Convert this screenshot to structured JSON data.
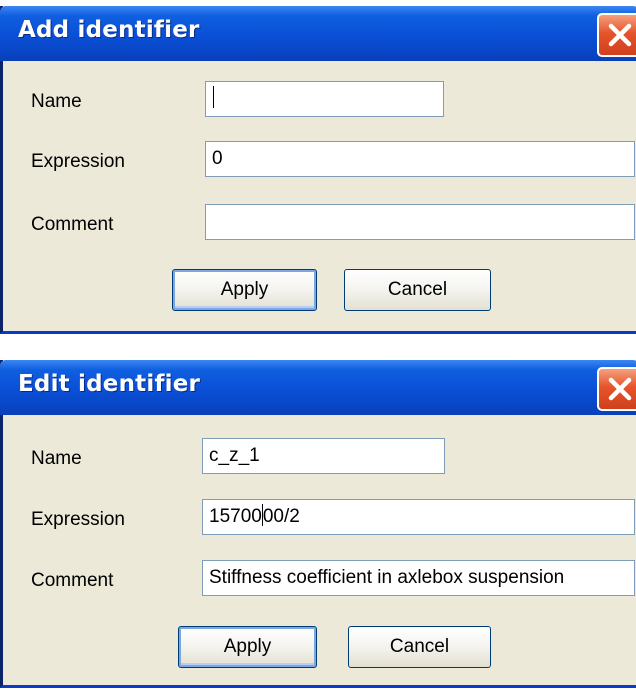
{
  "add_dialog": {
    "title": "Add identifier",
    "name_label": "Name",
    "name_value": "",
    "expression_label": "Expression",
    "expression_value": "0",
    "comment_label": "Comment",
    "comment_value": "",
    "apply_label": "Apply",
    "cancel_label": "Cancel",
    "close_icon": "close-icon"
  },
  "edit_dialog": {
    "title": "Edit identifier",
    "name_label": "Name",
    "name_value": "c_z_1",
    "expression_label": "Expression",
    "expression_before_caret": "15700",
    "expression_after_caret": "00/2",
    "comment_label": "Comment",
    "comment_value": "Stiffness coefficient in axlebox suspension",
    "apply_label": "Apply",
    "cancel_label": "Cancel",
    "close_icon": "close-icon"
  },
  "colors": {
    "titlebar": "#0a4fd6",
    "dialog_bg": "#ece9d8",
    "close_button": "#e6542c",
    "field_border": "#7f9db9"
  }
}
